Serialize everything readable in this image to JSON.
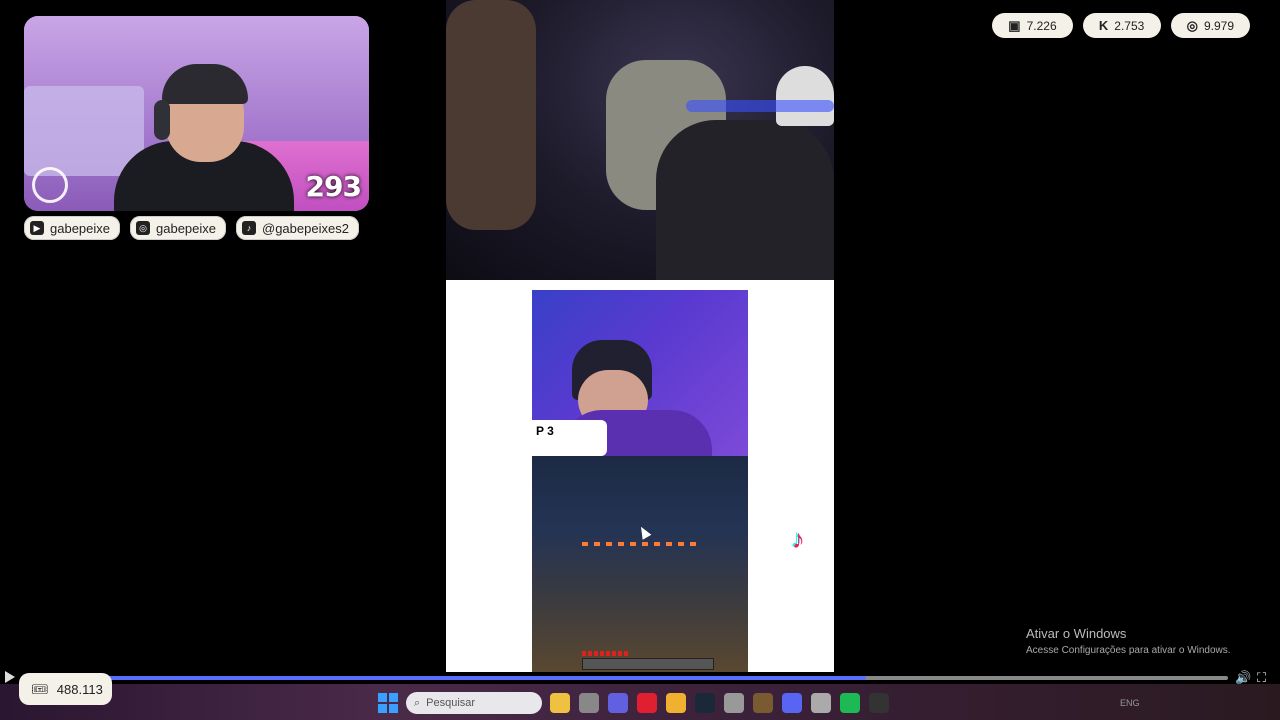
{
  "webcam": {
    "counter": "293"
  },
  "socials": [
    {
      "platform_icon": "youtube-icon",
      "handle": "gabepeixe"
    },
    {
      "platform_icon": "instagram-icon",
      "handle": "gabepeixe"
    },
    {
      "platform_icon": "tiktok-icon",
      "handle": "@gabepeixes2"
    }
  ],
  "stats": [
    {
      "icon": "twitch-icon",
      "glyph": "▣",
      "value": "7.226"
    },
    {
      "icon": "kick-icon",
      "glyph": "K",
      "value": "2.753"
    },
    {
      "icon": "globe-icon",
      "glyph": "◎",
      "value": "9.979"
    }
  ],
  "video": {
    "label_text": "P\n3"
  },
  "windows_watermark": {
    "title": "Ativar o Windows",
    "subtitle": "Acesse Configurações para ativar o Windows."
  },
  "player": {
    "progress_fraction": 0.7
  },
  "ticket": {
    "value": "488.113"
  },
  "taskbar": {
    "search_placeholder": "Pesquisar",
    "apps": [
      {
        "icon": "file-explorer-icon",
        "color": "#f0c040"
      },
      {
        "icon": "app-icon",
        "color": "#888888"
      },
      {
        "icon": "copilot-icon",
        "color": "#6060e0"
      },
      {
        "icon": "opera-icon",
        "color": "#e02030"
      },
      {
        "icon": "folder-icon",
        "color": "#f0b030"
      },
      {
        "icon": "steam-icon",
        "color": "#1b2838"
      },
      {
        "icon": "app-icon-2",
        "color": "#999999"
      },
      {
        "icon": "app-icon-3",
        "color": "#7a5a30"
      },
      {
        "icon": "discord-icon",
        "color": "#5865f2"
      },
      {
        "icon": "app-icon-4",
        "color": "#aaaaaa"
      },
      {
        "icon": "spotify-icon",
        "color": "#1db954"
      },
      {
        "icon": "obs-icon",
        "color": "#333333"
      }
    ],
    "tray_lang": "ENG"
  }
}
